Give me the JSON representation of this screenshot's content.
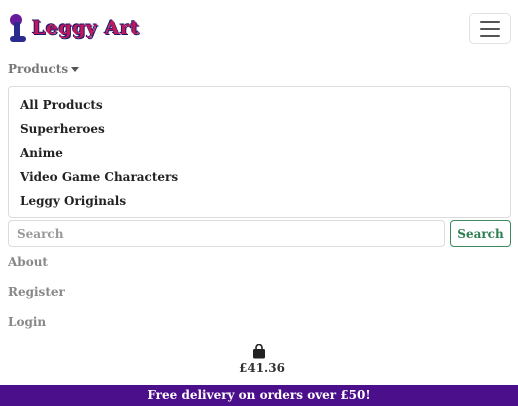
{
  "brand": {
    "name": "Leggy Art"
  },
  "navbar": {
    "toggle_icon": "hamburger-icon"
  },
  "products_menu": {
    "label": "Products",
    "items": [
      {
        "label": "All Products"
      },
      {
        "label": "Superheroes"
      },
      {
        "label": "Anime"
      },
      {
        "label": "Video Game Characters"
      },
      {
        "label": "Leggy Originals"
      }
    ]
  },
  "search": {
    "placeholder": "Search",
    "button_label": "Search"
  },
  "nav_links": {
    "about": "About",
    "register": "Register",
    "login": "Login"
  },
  "cart": {
    "icon": "shopping-bag-icon",
    "total": "£41.36"
  },
  "banner": {
    "text": "Free delivery on orders over £50!"
  },
  "colors": {
    "banner_bg": "#4b0f8c",
    "search_button": "#2e7d52",
    "logo_pink": "#c2185b",
    "logo_navy": "#1a1a6e"
  }
}
